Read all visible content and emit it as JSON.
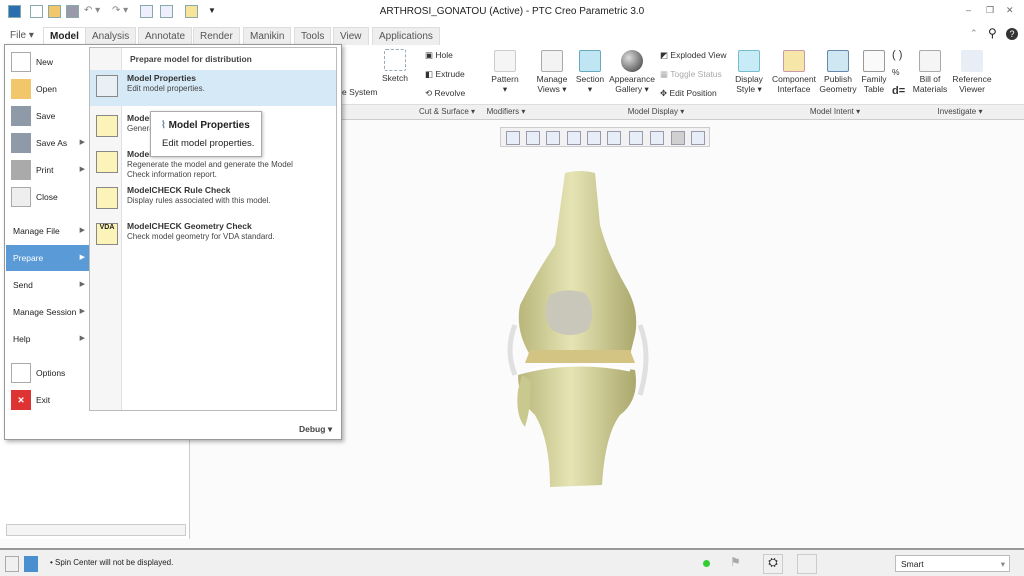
{
  "window": {
    "title": "ARTHROSI_GONATOU (Active) - PTC Creo Parametric 3.0"
  },
  "tabs": [
    "File",
    "Model",
    "Analysis",
    "Annotate",
    "Render",
    "Manikin",
    "Tools",
    "View",
    "Applications"
  ],
  "active_tab": "Model",
  "ribbon": {
    "sketch": "Sketch",
    "coord_system": "e System",
    "hole": "Hole",
    "extrude": "Extrude",
    "revolve": "Revolve",
    "pattern": "Pattern",
    "manage_views": "Manage Views",
    "section": "Section",
    "appearance": "Appearance Gallery",
    "exploded_view": "Exploded View",
    "toggle_status": "Toggle Status",
    "edit_position": "Edit Position",
    "display_style": "Display Style",
    "component_interface": "Component Interface",
    "publish_geometry": "Publish Geometry",
    "family_table": "Family Table",
    "bom": "Bill of Materials",
    "reference_viewer": "Reference Viewer",
    "groups": [
      "Cut & Surface",
      "Modifiers",
      "Model Display",
      "Model Intent",
      "Investigate"
    ]
  },
  "file_menu": {
    "items": [
      "New",
      "Open",
      "Save",
      "Save As",
      "Print",
      "Close",
      "Manage File",
      "Prepare",
      "Send",
      "Manage Session",
      "Help",
      "Options",
      "Exit"
    ],
    "selected": "Prepare",
    "submenu_title": "Prepare model for distribution",
    "submenu": [
      {
        "title": "Model Properties",
        "desc": "Edit model properties."
      },
      {
        "title": "Model",
        "desc": "Genera                                    part, assem"
      },
      {
        "title": "Model",
        "desc": "Regenerate the model and generate the Model Check information report."
      },
      {
        "title": "ModelCHECK Rule Check",
        "desc": "Display rules associated with this model."
      },
      {
        "title": "ModelCHECK Geometry Check",
        "desc": "Check model geometry for VDA standard."
      }
    ],
    "debug": "Debug"
  },
  "tooltip": {
    "title": "Model Properties",
    "desc": "Edit model properties."
  },
  "status": {
    "message": "Spin Center will not be displayed.",
    "filter": "Smart"
  },
  "colors": {
    "accent": "#5a9ad6",
    "highlight": "#d6e9f6",
    "model": "#d7d5a0"
  }
}
